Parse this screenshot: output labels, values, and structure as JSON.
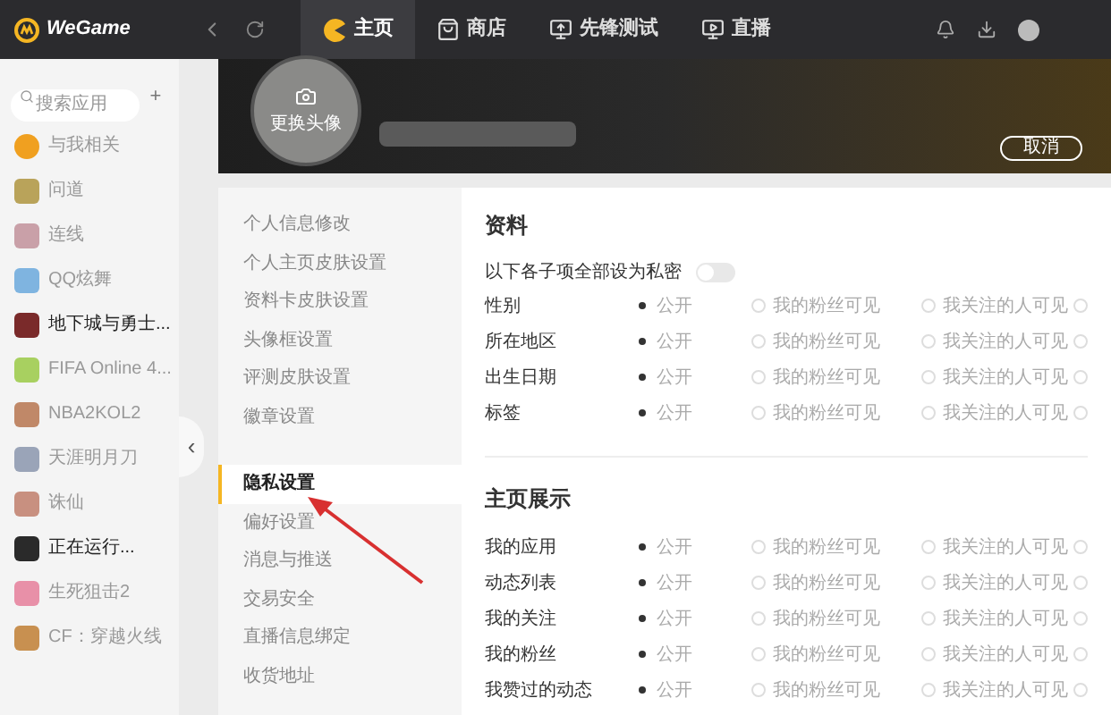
{
  "app": {
    "logo": "WeGame"
  },
  "tabs": [
    {
      "label": "主页",
      "selected": true,
      "kind": "home"
    },
    {
      "label": "商店",
      "selected": false,
      "kind": "store"
    },
    {
      "label": "先锋测试",
      "selected": false,
      "kind": "test"
    },
    {
      "label": "直播",
      "selected": false,
      "kind": "live"
    }
  ],
  "sidebar": {
    "search": {
      "placeholder": "搜索应用"
    },
    "add": "+",
    "collapse": "‹",
    "items": [
      {
        "label": "与我相关",
        "emphasized": false
      },
      {
        "label": "问道",
        "emphasized": false
      },
      {
        "label": "连线",
        "emphasized": false
      },
      {
        "label": "QQ炫舞",
        "emphasized": false
      },
      {
        "label": "地下城与勇士...",
        "emphasized": true
      },
      {
        "label": "FIFA Online 4...",
        "emphasized": false
      },
      {
        "label": "NBA2KOL2",
        "emphasized": false
      },
      {
        "label": "天涯明月刀",
        "emphasized": false
      },
      {
        "label": "诛仙",
        "emphasized": false
      },
      {
        "label": "正在运行...",
        "emphasized": true
      },
      {
        "label": "生死狙击2",
        "emphasized": false
      },
      {
        "label": "CF：穿越火线",
        "emphasized": false
      }
    ]
  },
  "profile": {
    "avatar_label": "更换头像",
    "cancel": "取消"
  },
  "settings_menu": {
    "groups": [
      [
        {
          "label": "个人信息修改",
          "selected": false
        },
        {
          "label": "个人主页皮肤设置",
          "selected": false
        },
        {
          "label": "资料卡皮肤设置",
          "selected": false
        },
        {
          "label": "头像框设置",
          "selected": false
        },
        {
          "label": "评测皮肤设置",
          "selected": false
        },
        {
          "label": "徽章设置",
          "selected": false
        }
      ],
      [
        {
          "label": "隐私设置",
          "selected": true
        },
        {
          "label": "偏好设置",
          "selected": false
        },
        {
          "label": "消息与推送",
          "selected": false
        },
        {
          "label": "交易安全",
          "selected": false
        },
        {
          "label": "直播信息绑定",
          "selected": false
        },
        {
          "label": "收货地址",
          "selected": false
        }
      ]
    ]
  },
  "sections": [
    {
      "title": "资料",
      "private_all": {
        "label": "以下各子项全部设为私密",
        "on": false
      },
      "rows": [
        {
          "label": "性别",
          "options": [
            {
              "label": "公开",
              "selected": true
            },
            {
              "label": "我的粉丝可见",
              "selected": false
            },
            {
              "label": "我关注的人可见",
              "selected": false
            },
            {
              "selected": false
            }
          ]
        },
        {
          "label": "所在地区",
          "options": [
            {
              "label": "公开",
              "selected": true
            },
            {
              "label": "我的粉丝可见",
              "selected": false
            },
            {
              "label": "我关注的人可见",
              "selected": false
            },
            {
              "selected": false
            }
          ]
        },
        {
          "label": "出生日期",
          "options": [
            {
              "label": "公开",
              "selected": true
            },
            {
              "label": "我的粉丝可见",
              "selected": false
            },
            {
              "label": "我关注的人可见",
              "selected": false
            },
            {
              "selected": false
            }
          ]
        },
        {
          "label": "标签",
          "options": [
            {
              "label": "公开",
              "selected": true
            },
            {
              "label": "我的粉丝可见",
              "selected": false
            },
            {
              "label": "我关注的人可见",
              "selected": false
            },
            {
              "selected": false
            }
          ]
        }
      ]
    },
    {
      "title": "主页展示",
      "rows": [
        {
          "label": "我的应用",
          "options": [
            {
              "label": "公开",
              "selected": true
            },
            {
              "label": "我的粉丝可见",
              "selected": false
            },
            {
              "label": "我关注的人可见",
              "selected": false
            },
            {
              "selected": false
            }
          ]
        },
        {
          "label": "动态列表",
          "options": [
            {
              "label": "公开",
              "selected": true
            },
            {
              "label": "我的粉丝可见",
              "selected": false
            },
            {
              "label": "我关注的人可见",
              "selected": false
            },
            {
              "selected": false
            }
          ]
        },
        {
          "label": "我的关注",
          "options": [
            {
              "label": "公开",
              "selected": true
            },
            {
              "label": "我的粉丝可见",
              "selected": false
            },
            {
              "label": "我关注的人可见",
              "selected": false
            },
            {
              "selected": false
            }
          ]
        },
        {
          "label": "我的粉丝",
          "options": [
            {
              "label": "公开",
              "selected": true
            },
            {
              "label": "我的粉丝可见",
              "selected": false
            },
            {
              "label": "我关注的人可见",
              "selected": false
            },
            {
              "selected": false
            }
          ]
        },
        {
          "label": "我赞过的动态",
          "options": [
            {
              "label": "公开",
              "selected": true
            },
            {
              "label": "我的粉丝可见",
              "selected": false
            },
            {
              "label": "我关注的人可见",
              "selected": false
            },
            {
              "selected": false
            }
          ]
        }
      ]
    }
  ]
}
